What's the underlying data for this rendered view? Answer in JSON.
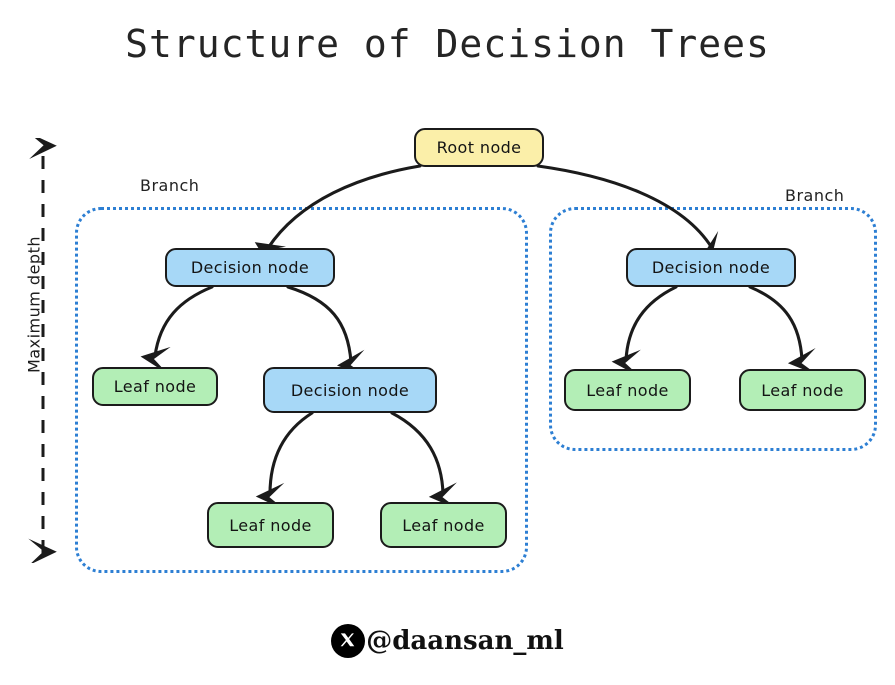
{
  "title": "Structure of Decision Trees",
  "colors": {
    "root_fill": "#fbefa9",
    "decision_fill": "#a7d8f7",
    "leaf_fill": "#b3eeb6",
    "node_stroke": "#1b1b1b",
    "branch_border": "#2d7fd3",
    "edge_stroke": "#1b1b1b",
    "text": "#141414",
    "background": "#ffffff"
  },
  "depth_measure": {
    "label": "Maximum depth"
  },
  "branches": [
    {
      "label": "Branch"
    },
    {
      "label": "Branch"
    }
  ],
  "nodes": [
    {
      "id": "root",
      "label": "Root node",
      "type": "root"
    },
    {
      "id": "l-dec-1",
      "label": "Decision node",
      "type": "decision"
    },
    {
      "id": "l-leaf-1",
      "label": "Leaf node",
      "type": "leaf"
    },
    {
      "id": "l-dec-2",
      "label": "Decision node",
      "type": "decision"
    },
    {
      "id": "l-leaf-2",
      "label": "Leaf node",
      "type": "leaf"
    },
    {
      "id": "l-leaf-3",
      "label": "Leaf node",
      "type": "leaf"
    },
    {
      "id": "r-dec-1",
      "label": "Decision node",
      "type": "decision"
    },
    {
      "id": "r-leaf-1",
      "label": "Leaf node",
      "type": "leaf"
    },
    {
      "id": "r-leaf-2",
      "label": "Leaf node",
      "type": "leaf"
    }
  ],
  "footer": {
    "icon": "x-twitter-icon",
    "handle": "@daansan_ml"
  }
}
